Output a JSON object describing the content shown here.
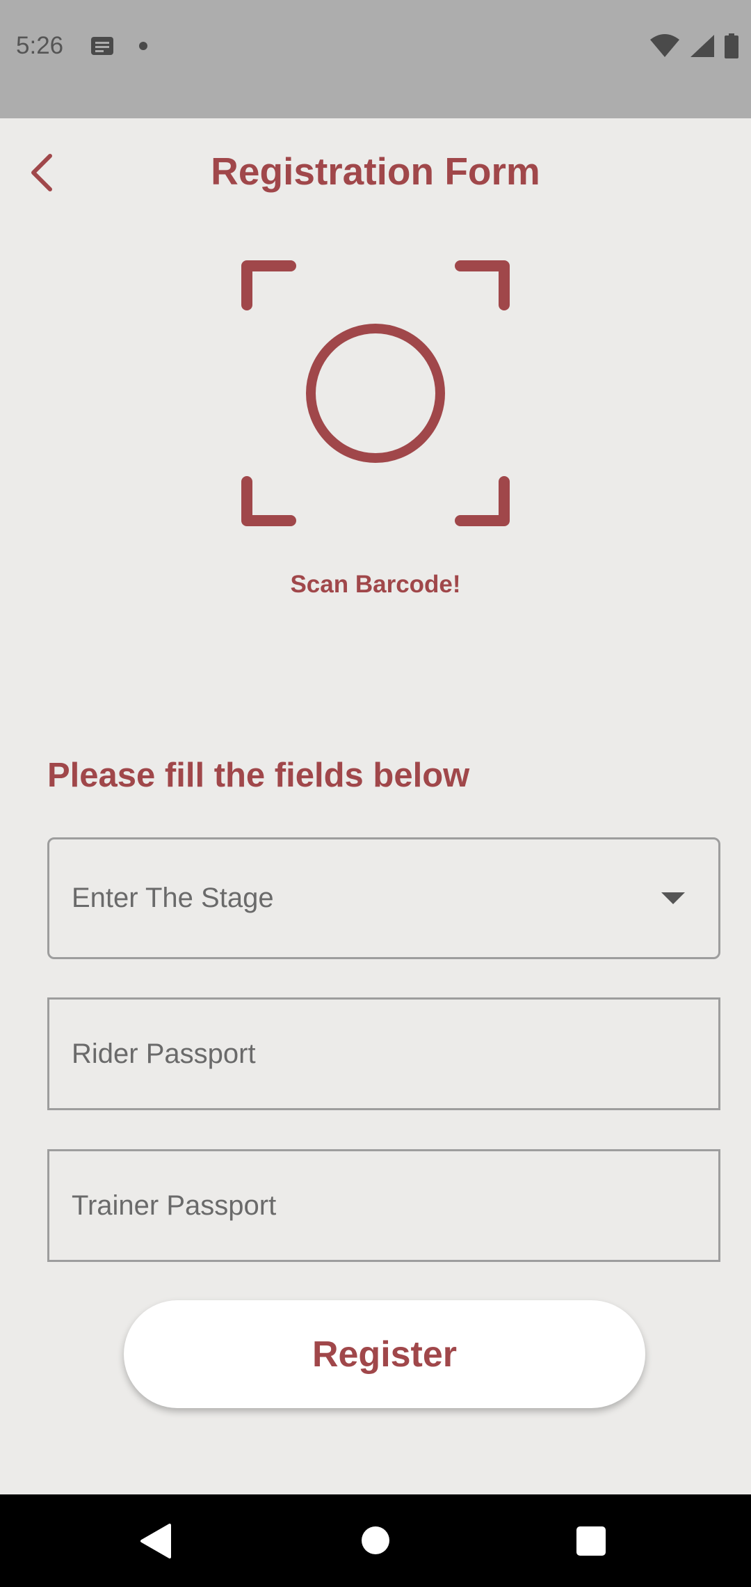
{
  "status_bar": {
    "time": "5:26",
    "icons": [
      "notification-icon",
      "dot-icon",
      "wifi-icon",
      "signal-icon",
      "battery-icon"
    ]
  },
  "app_bar": {
    "title": "Registration Form",
    "back_icon": "chevron-left-icon"
  },
  "scanner": {
    "icon": "barcode-scanner-icon",
    "label": "Scan Barcode!"
  },
  "form": {
    "heading": "Please fill the fields below",
    "stage_dropdown": {
      "placeholder": "Enter The Stage",
      "icon": "dropdown-arrow-icon"
    },
    "rider_passport": {
      "placeholder": "Rider Passport",
      "value": ""
    },
    "trainer_passport": {
      "placeholder": "Trainer Passport",
      "value": ""
    },
    "register_label": "Register"
  },
  "nav_bar": {
    "icons": [
      "back-triangle-icon",
      "home-circle-icon",
      "recents-square-icon"
    ]
  },
  "colors": {
    "accent": "#a0474a",
    "background": "#ecebe9",
    "status_bar": "#adadad",
    "nav_bar": "#000000"
  }
}
